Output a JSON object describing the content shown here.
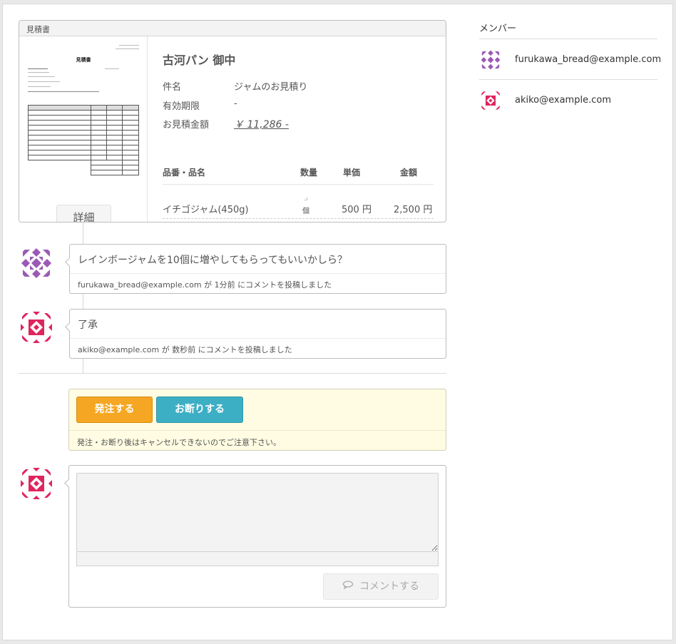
{
  "estimate": {
    "header": "見積書",
    "company": "古河パン 御中",
    "fields": [
      {
        "label": "件名",
        "value": "ジャムのお見積り"
      },
      {
        "label": "有効期限",
        "value": "-"
      },
      {
        "label": "お見積金額",
        "value": "￥ 11,286 -"
      }
    ],
    "detail_label": "詳細",
    "doc_title": "見積書",
    "columns": {
      "name": "品番・品名",
      "qty": "数量",
      "unit_price": "単価",
      "amount": "金額"
    },
    "items": [
      {
        "name": "イチゴジャム(450g)",
        "qty": "5",
        "qty_unit": "個",
        "unit_price": "500 円",
        "amount": "2,500 円"
      }
    ]
  },
  "comments": [
    {
      "text": "レインボージャムを10個に増やしてもらってもいいかしら？",
      "meta": "furukawa_bread@example.com が 1分前 にコメントを投稿しました"
    },
    {
      "text": "了承",
      "meta": "akiko@example.com が 数秒前 にコメントを投稿しました"
    }
  ],
  "actions": {
    "order_label": "発注する",
    "decline_label": "お断りする",
    "note": "発注・お断り後はキャンセルできないのでご注意下さい。"
  },
  "compose": {
    "comment_label": "コメントする",
    "comment_icon": "speech-bubble-icon"
  },
  "members": {
    "title": "メンバー",
    "list": [
      {
        "email": "furukawa_bread@example.com",
        "avatar_color": "#9b59b6"
      },
      {
        "email": "akiko@example.com",
        "avatar_color": "#e0245e"
      }
    ]
  },
  "colors": {
    "order": "#f5a623",
    "decline": "#3dafc4",
    "notice_bg": "#fffce3"
  }
}
